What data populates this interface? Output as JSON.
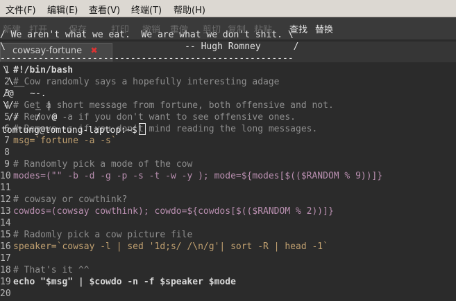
{
  "menu": [
    "文件(F)",
    "编辑(E)",
    "查看(V)",
    "终端(T)",
    "帮助(H)"
  ],
  "toolbar_ghost": {
    "left": [
      "新建",
      "打开",
      "保存",
      "打印",
      "撤销",
      "重做",
      "剪切",
      "复制",
      "粘贴"
    ],
    "right": [
      "查找",
      "替换"
    ]
  },
  "tab": {
    "label": "cowsay-fortune",
    "close": "✖"
  },
  "terminal": {
    "line1": "/ We aren't what we eat.  We are what we don't shit. \\",
    "line2": "\\                                 -- Hugh Romney      /",
    "line3": "------------------------------------------------------",
    "cow1": "\\",
    "cow2": " \\__",
    "cow3": "/@   ~-.",
    "cow4": "\\/    _ |",
    "cow5": " //   /  @",
    "prompt": "tomtung@tomtung-laptop:~$"
  },
  "code_lines": [
    {
      "n": "1",
      "t": "#!/bin/bash"
    },
    {
      "n": "2",
      "t": "# Cow randomly says a hopefully interesting adage"
    },
    {
      "n": "3",
      "t": ""
    },
    {
      "n": "4",
      "t": "# Get a short message from fortune, both offensive and not."
    },
    {
      "n": "5",
      "t": "# Remove -a if you don't want to see offensive ones."
    },
    {
      "n": "6",
      "t": "# Remove -s if you don't mind reading the long messages."
    },
    {
      "n": "7",
      "t": "msg=`fortune -a -s`"
    },
    {
      "n": "8",
      "t": ""
    },
    {
      "n": "9",
      "t": "# Randomly pick a mode of the cow"
    },
    {
      "n": "10",
      "t": "modes=(\"\" -b -d -g -p -s -t -w -y ); mode=${modes[$(($RANDOM % 9))]}"
    },
    {
      "n": "11",
      "t": ""
    },
    {
      "n": "12",
      "t": "# cowsay or cowthink?"
    },
    {
      "n": "13",
      "t": "cowdos=(cowsay cowthink); cowdo=${cowdos[$(($RANDOM % 2))]}"
    },
    {
      "n": "14",
      "t": ""
    },
    {
      "n": "15",
      "t": "# Radomly pick a cow picture file"
    },
    {
      "n": "16",
      "t": "speaker=`cowsay -l | sed '1d;s/ /\\n/g'| sort -R | head -1`"
    },
    {
      "n": "17",
      "t": ""
    },
    {
      "n": "18",
      "t": "# That's it ^^"
    },
    {
      "n": "19",
      "t": "echo \"$msg\" | $cowdo -n -f $speaker $mode"
    },
    {
      "n": "20",
      "t": ""
    }
  ]
}
